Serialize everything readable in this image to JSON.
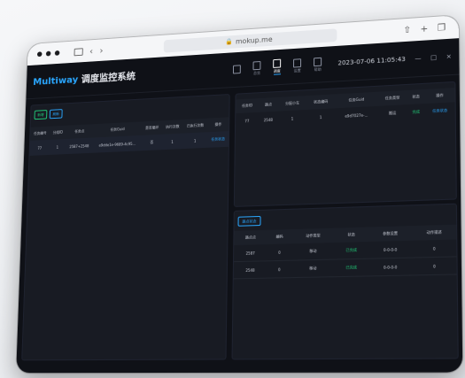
{
  "browser": {
    "address": "mokup.me"
  },
  "app": {
    "title_brand": "Multiway",
    "title_rest": " 调度监控系统",
    "nav": [
      {
        "label": "",
        "active": false
      },
      {
        "label": "总览",
        "active": false
      },
      {
        "label": "调度",
        "active": true
      },
      {
        "label": "设置",
        "active": false
      },
      {
        "label": "帮助",
        "active": false
      }
    ],
    "datetime": "2023-07-06 11:05:43",
    "win_min": "—",
    "win_max": "□",
    "win_close": "×"
  },
  "left": {
    "btn_add": "新增",
    "btn_refresh": "刷新",
    "headers": [
      "任务编号",
      "分组ID",
      "任务点",
      "任务Guid",
      "是否循环",
      "执行次数",
      "已执行次数",
      "操作"
    ],
    "rows": [
      [
        "77",
        "1",
        "2587+2548",
        "e9dde1e-9689-4c95...",
        "否",
        "1",
        "1",
        "任务状态"
      ]
    ]
  },
  "right_top": {
    "headers": [
      "任务ID",
      "路点",
      "分配小车",
      "状态编码",
      "任务Guid",
      "任务类型",
      "状态",
      "操作"
    ],
    "rows": [
      [
        "77",
        "2548",
        "1",
        "1",
        "e9d7027e-...",
        "搬运",
        "完成",
        "任务状态"
      ]
    ]
  },
  "right_bottom": {
    "btn_label": "路点状态",
    "headers": [
      "路点点",
      "编码",
      "动作类型",
      "状态",
      "参数设置",
      "动作描述"
    ],
    "rows": [
      [
        "2587",
        "0",
        "移动",
        "已完成",
        "0-0-0-0",
        "0"
      ],
      [
        "2548",
        "0",
        "移动",
        "已完成",
        "0-0-0-0",
        "0"
      ]
    ]
  },
  "colors": {
    "accent_blue": "#2aa7ff",
    "accent_green": "#21d17b"
  }
}
